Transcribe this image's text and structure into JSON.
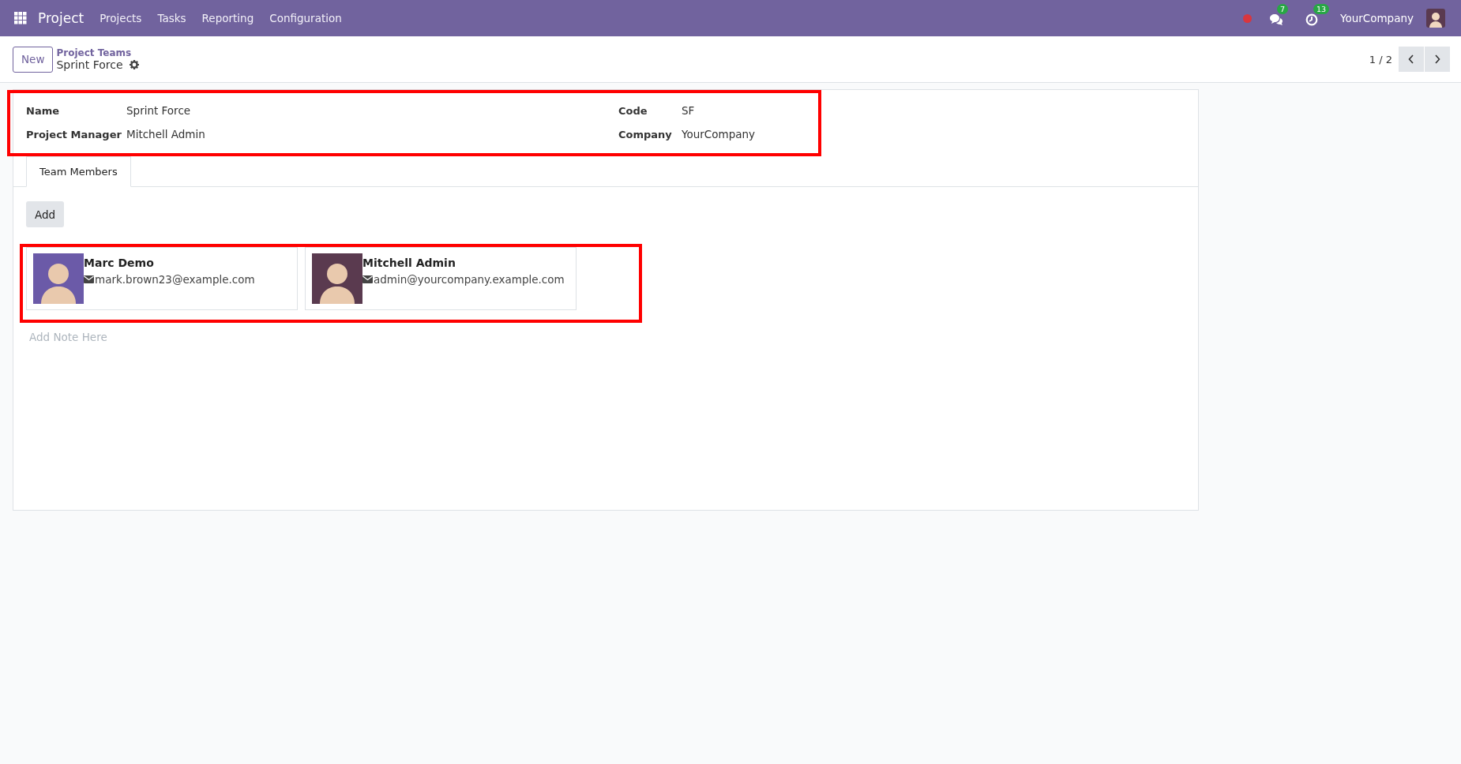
{
  "navbar": {
    "app_name": "Project",
    "menu": [
      "Projects",
      "Tasks",
      "Reporting",
      "Configuration"
    ],
    "messages_count": "7",
    "activities_count": "13",
    "company": "YourCompany"
  },
  "control_panel": {
    "new_button": "New",
    "breadcrumb": "Project Teams",
    "record_title": "Sprint Force",
    "pager": "1 / 2"
  },
  "form": {
    "fields": [
      {
        "label": "Name",
        "value": "Sprint Force"
      },
      {
        "label": "Code",
        "value": "SF"
      },
      {
        "label": "Project Manager",
        "value": "Mitchell Admin"
      },
      {
        "label": "Company",
        "value": "YourCompany"
      }
    ],
    "tabs": [
      {
        "label": "Team Members",
        "selected": true
      }
    ],
    "add_button": "Add",
    "members": [
      {
        "name": "Marc Demo",
        "email": "mark.brown23@example.com",
        "color": "#6b5aa8"
      },
      {
        "name": "Mitchell Admin",
        "email": "admin@yourcompany.example.com",
        "color": "#5a3a4f"
      }
    ],
    "note_placeholder": "Add Note Here"
  }
}
